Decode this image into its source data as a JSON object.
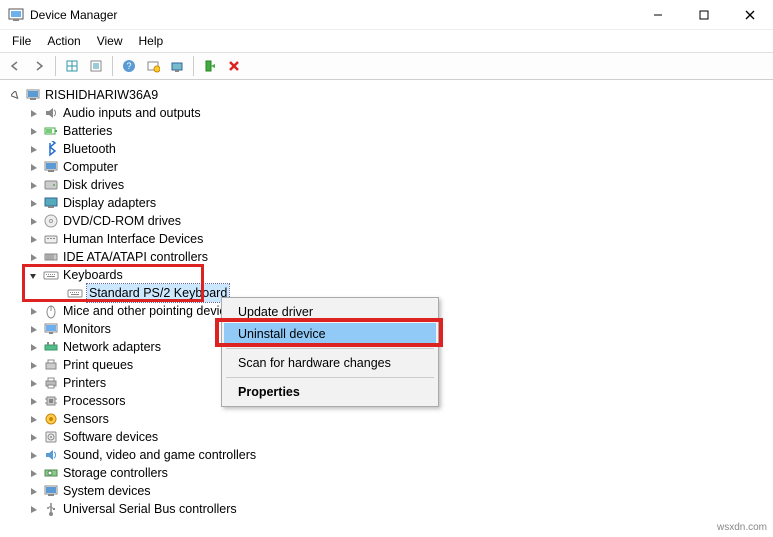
{
  "window": {
    "title": "Device Manager"
  },
  "menubar": [
    "File",
    "Action",
    "View",
    "Help"
  ],
  "tree": {
    "root": "RISHIDHARIW36A9",
    "nodes": [
      "Audio inputs and outputs",
      "Batteries",
      "Bluetooth",
      "Computer",
      "Disk drives",
      "Display adapters",
      "DVD/CD-ROM drives",
      "Human Interface Devices",
      "IDE ATA/ATAPI controllers",
      "Keyboards",
      "Mice and other pointing devices",
      "Monitors",
      "Network adapters",
      "Print queues",
      "Printers",
      "Processors",
      "Sensors",
      "Software devices",
      "Sound, video and game controllers",
      "Storage controllers",
      "System devices",
      "Universal Serial Bus controllers"
    ],
    "keyboards_child": "Standard PS/2 Keyboard"
  },
  "context_menu": {
    "update": "Update driver",
    "uninstall": "Uninstall device",
    "scan": "Scan for hardware changes",
    "properties": "Properties"
  },
  "watermark": "wsxdn.com"
}
